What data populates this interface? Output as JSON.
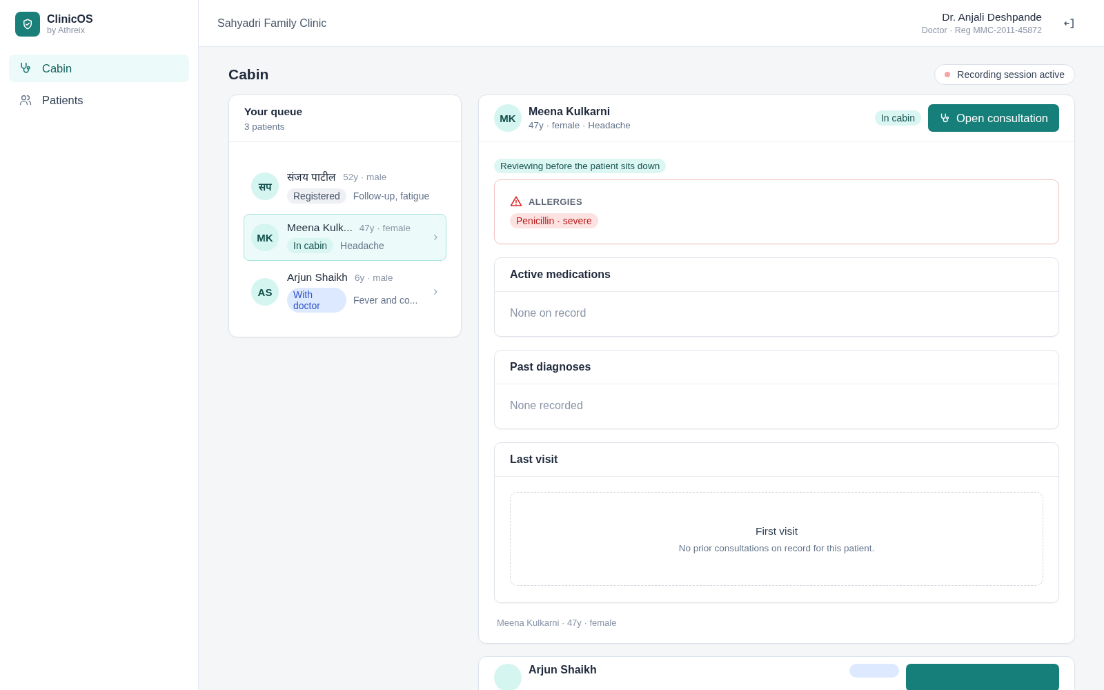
{
  "brand": {
    "name": "ClinicOS",
    "subtitle": "by Athreix"
  },
  "nav": [
    {
      "label": "Cabin",
      "selected": true
    },
    {
      "label": "Patients",
      "selected": false
    }
  ],
  "header": {
    "clinic": "Sahyadri Family Clinic",
    "user_name": "Dr. Anjali Deshpande",
    "user_role": "Doctor · Reg MMC-2011-45872"
  },
  "page": {
    "title": "Cabin",
    "recording_badge": "Recording session active"
  },
  "queue": {
    "title": "Your queue",
    "count": "3 patients",
    "items": [
      {
        "initials": "सप",
        "name": "संजय पाटील",
        "meta": "52y · male",
        "status": {
          "label": "Registered",
          "kind": "registered"
        },
        "reason": "Follow-up, fatigue",
        "selected": false,
        "chevron": false
      },
      {
        "initials": "MK",
        "name": "Meena Kulk...",
        "meta": "47y · female",
        "status": {
          "label": "In cabin",
          "kind": "in_cabin"
        },
        "reason": "Headache",
        "selected": true,
        "chevron": true
      },
      {
        "initials": "AS",
        "name": "Arjun Shaikh",
        "meta": "6y · male",
        "status": {
          "label": "With doctor",
          "kind": "with_doctor"
        },
        "reason": "Fever and co...",
        "selected": false,
        "chevron": true
      }
    ]
  },
  "detail": {
    "initials": "MK",
    "name": "Meena Kulkarni",
    "meta": "47y · female · Headache",
    "status": {
      "label": "In cabin",
      "kind": "in_cabin"
    },
    "action": "Open consultation",
    "note": "Reviewing before the patient sits down",
    "allergies": {
      "title": "ALLERGIES",
      "items": [
        "Penicillin · severe"
      ]
    },
    "sections": [
      {
        "title": "Active medications",
        "kind": "text",
        "text": "None on record"
      },
      {
        "title": "Past diagnoses",
        "kind": "text",
        "text": "None recorded"
      },
      {
        "title": "Last visit",
        "kind": "empty",
        "heading": "First visit",
        "text": "No prior consultations on record for this patient."
      }
    ],
    "footer": "Meena Kulkarni · 47y · female"
  },
  "next_card": {
    "name": "Arjun Shaikh"
  }
}
